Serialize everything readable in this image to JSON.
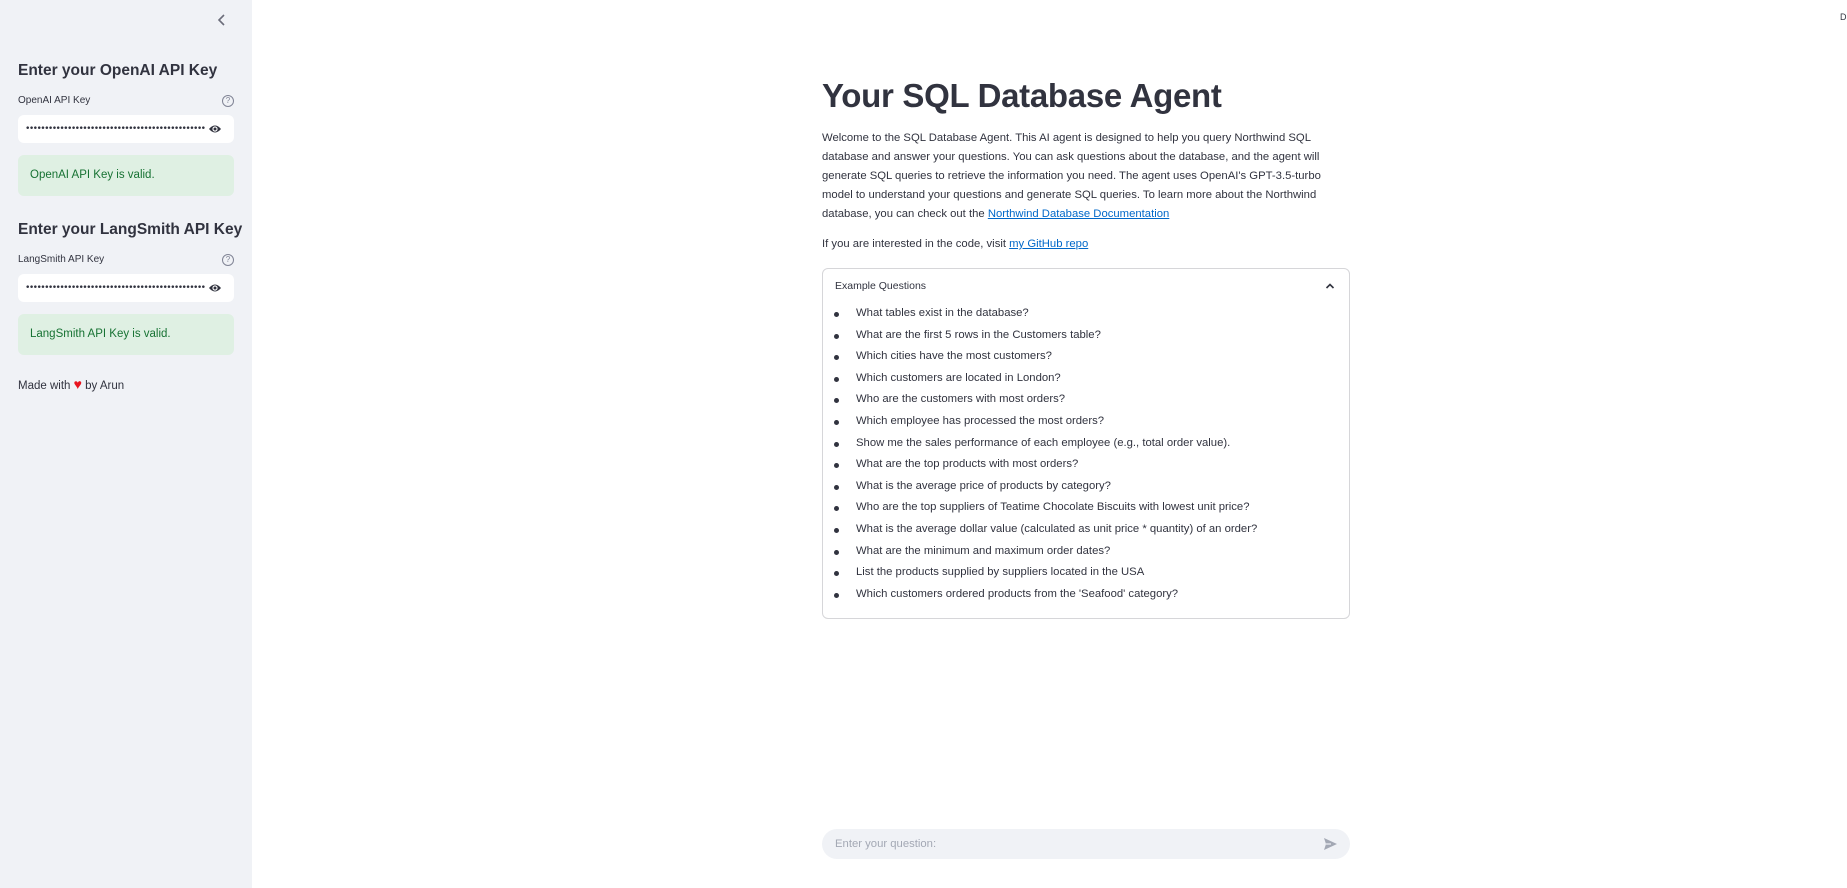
{
  "sidebar": {
    "openai": {
      "heading": "Enter your OpenAI API Key",
      "label": "OpenAI API Key",
      "help": "?",
      "value": "••••••••••••••••••••••••••••••••••••••••••••••••••••",
      "status": "OpenAI API Key is valid."
    },
    "langsmith": {
      "heading": "Enter your LangSmith API Key",
      "label": "LangSmith API Key",
      "help": "?",
      "value": "••••••••••••••••••••••••••••••••••••••••••••••••••••",
      "status": "LangSmith API Key is valid."
    },
    "footer": {
      "prefix": "Made with",
      "heart": "♥",
      "suffix": "by Arun"
    }
  },
  "main": {
    "title": "Your SQL Database Agent",
    "intro_text": "Welcome to the SQL Database Agent. This AI agent is designed to help you query Northwind SQL database and answer your questions. You can ask questions about the database, and the agent will generate SQL queries to retrieve the information you need. The agent uses OpenAI's GPT-3.5-turbo model to understand your questions and generate SQL queries. To learn more about the Northwind database, you can check out the ",
    "intro_link": "Northwind Database Documentation",
    "github_prefix": "If you are interested in the code, visit ",
    "github_link": "my GitHub repo",
    "expander": {
      "title": "Example Questions",
      "questions": [
        "What tables exist in the database?",
        "What are the first 5 rows in the Customers table?",
        "Which cities have the most customers?",
        "Which customers are located in London?",
        "Who are the customers with most orders?",
        "Which employee has processed the most orders?",
        "Show me the sales performance of each employee (e.g., total order value).",
        "What are the top products with most orders?",
        "What is the average price of products by category?",
        "Who are the top suppliers of Teatime Chocolate Biscuits with lowest unit price?",
        "What is the average dollar value (calculated as unit price * quantity) of an order?",
        "What are the minimum and maximum order dates?",
        "List the products supplied by suppliers located in the USA",
        "Which customers ordered products from the 'Seafood' category?"
      ]
    },
    "chat": {
      "placeholder": "Enter your question:"
    },
    "corner_text": "D"
  },
  "colors": {
    "sidebar_bg": "#f0f2f6",
    "success_bg": "#dff0e3",
    "success_text": "#177233",
    "link": "#0068c9",
    "heart": "#e8141f"
  }
}
